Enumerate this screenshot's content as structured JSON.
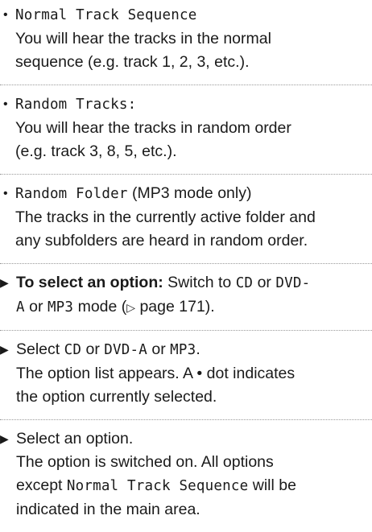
{
  "bullets": [
    {
      "title": "Normal Track Sequence",
      "suffix": "",
      "lines": [
        "You will hear the tracks in the normal",
        "sequence (e.g. track 1, 2, 3, etc.)."
      ]
    },
    {
      "title": "Random Tracks:",
      "suffix": "",
      "lines": [
        "You will hear the tracks in random order",
        "(e.g. track 3, 8, 5, etc.)."
      ]
    },
    {
      "title": "Random Folder",
      "suffix": " (MP3 mode only)",
      "lines": [
        "The tracks in the currently active folder and",
        "any subfolders are heard in random order."
      ]
    }
  ],
  "steps": {
    "s1": {
      "bold": "To select an option:",
      "t1": " Switch to ",
      "m1": "CD",
      "t2": " or ",
      "m2": "DVD-",
      "m3": "A",
      "t3": " or ",
      "m4": "MP3",
      "t4": " mode (",
      "ref_icon": "▷",
      "t5": " page 171)."
    },
    "s2": {
      "t1": "Select ",
      "m1": "CD",
      "t2": " or ",
      "m2": "DVD-A",
      "t3": " or ",
      "m3": "MP3",
      "t4": ".",
      "l2": "The option list appears. A ",
      "dot": "•",
      "l2b": " dot indicates",
      "l3": "the option currently selected."
    },
    "s3": {
      "l1": "Select an option.",
      "l2": "The option is switched on. All options",
      "l3a": "except ",
      "l3m": "Normal Track Sequence",
      "l3b": " will be",
      "l4": "indicated in the main area."
    }
  },
  "icons": {
    "bullet": "•",
    "step": "▶"
  }
}
